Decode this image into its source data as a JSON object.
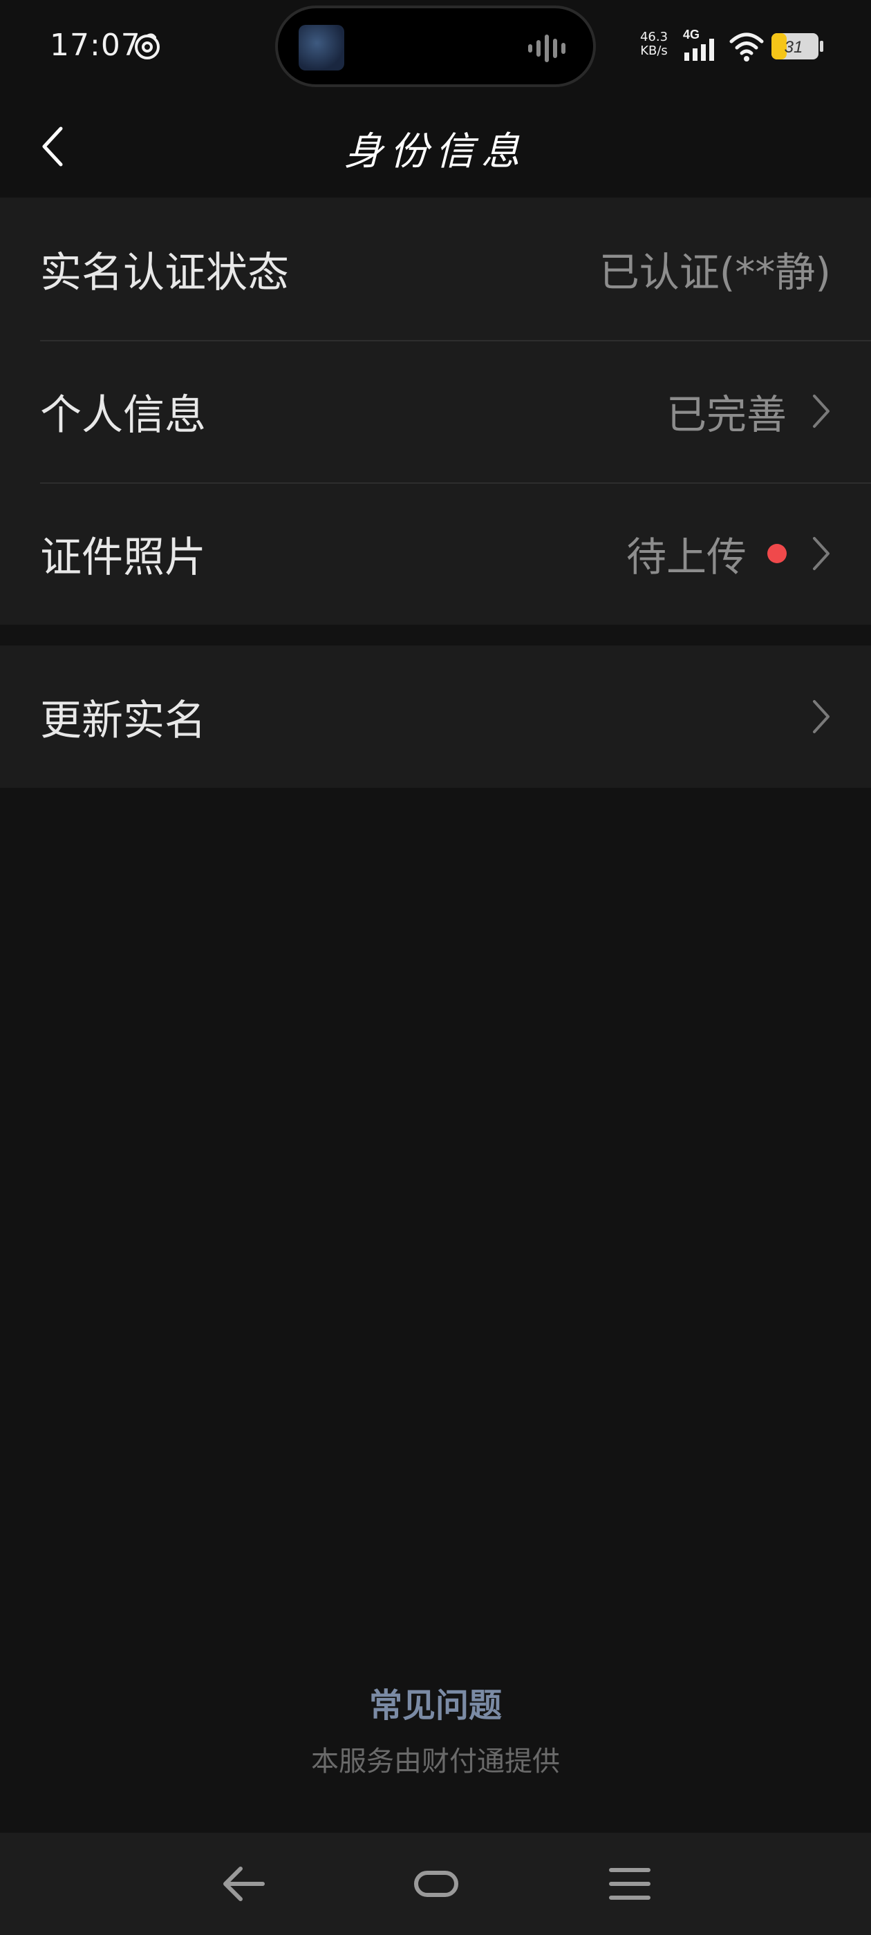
{
  "status_bar": {
    "time": "17:07",
    "net_speed_value": "46.3",
    "net_speed_unit": "KB/s",
    "network_type": "4G",
    "battery_level": "31",
    "icons": [
      "netease-music-icon",
      "audio-wave-icon",
      "signal-icon",
      "wifi-icon",
      "battery-icon"
    ]
  },
  "header": {
    "title": "身份信息",
    "back_icon": "chevron-left-icon"
  },
  "identity_group": {
    "items": [
      {
        "label": "实名认证状态",
        "value": "已认证(**静)"
      },
      {
        "label": "个人信息",
        "value": "已完善"
      },
      {
        "label": "证件照片",
        "value": "待上传"
      }
    ]
  },
  "update_group": {
    "items": [
      {
        "label": "更新实名"
      }
    ]
  },
  "footer": {
    "faq_label": "常见问题",
    "provider_text": "本服务由财付通提供"
  },
  "nav_bar": {
    "icons": [
      "back-arrow-icon",
      "home-pill-icon",
      "menu-lines-icon"
    ]
  },
  "colors": {
    "background": "#121212",
    "card": "#1c1c1c",
    "badge_red": "#f0494b",
    "faq_link": "#7b8ba5",
    "battery_yellow": "#f5c518"
  }
}
